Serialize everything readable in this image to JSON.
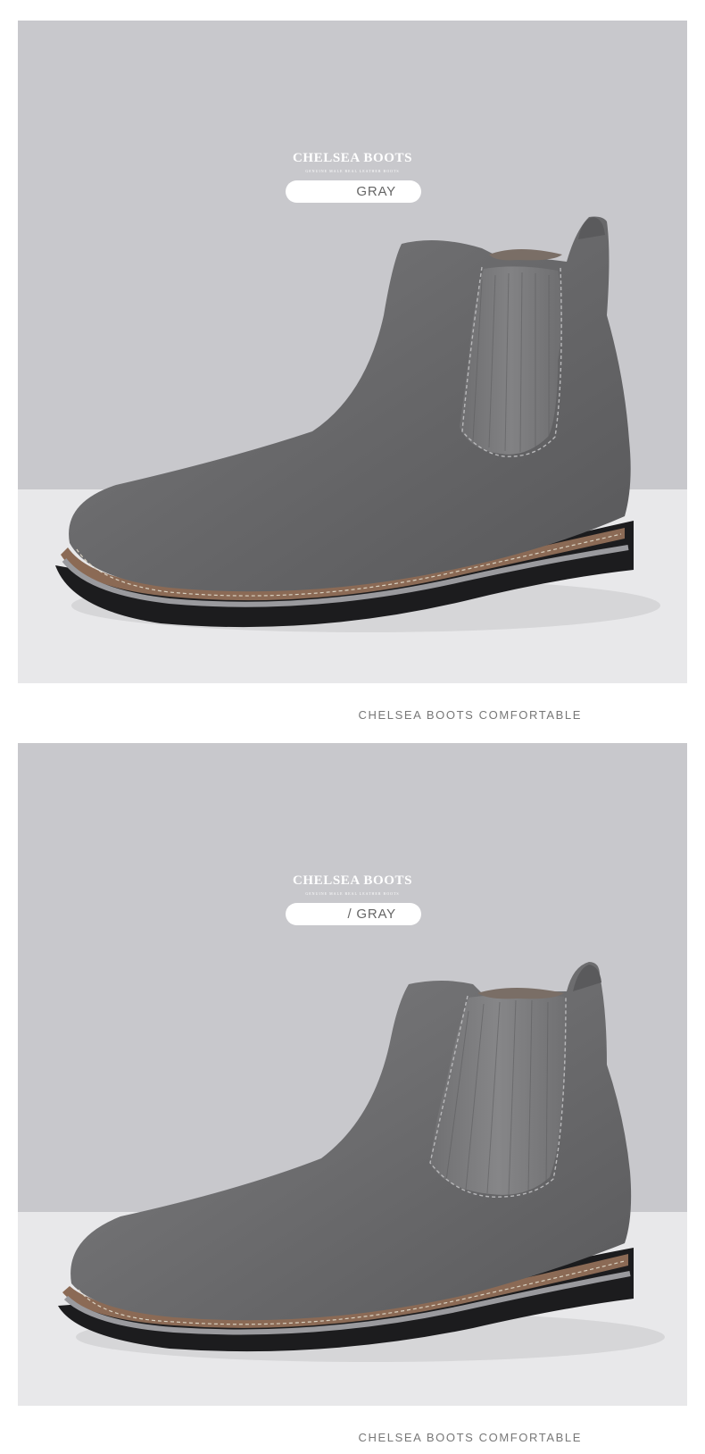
{
  "sections": [
    {
      "heading": "CHELSEA BOOTS",
      "subheading": "GENUINE MALE REAL LEATHER BOOTS",
      "color_label": "GRAY",
      "caption": "CHELSEA BOOTS COMFORTABLE"
    },
    {
      "heading": "CHELSEA BOOTS",
      "subheading": "GENUINE MALE REAL LEATHER BOOTS",
      "color_label": "/ GRAY",
      "caption": "CHELSEA BOOTS COMFORTABLE"
    }
  ],
  "colors": {
    "backdrop": "#c8c8cc",
    "floor": "#e8e8ea",
    "suede": "#6a6a6c",
    "sole": "#1c1c1e",
    "welt": "#8b6a55"
  },
  "images": [
    "chelsea-boot-gray-photo",
    "chelsea-boot-gray-photo"
  ]
}
